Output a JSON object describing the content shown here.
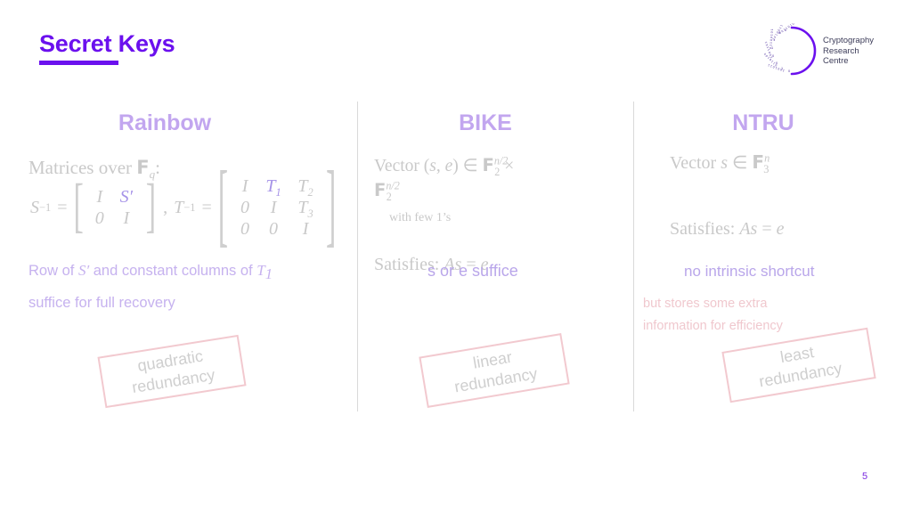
{
  "slide": {
    "title": "Secret Keys",
    "page_number": "5",
    "accent_color": "#6b10ee",
    "heading_color": "#c2a6ef",
    "math_color": "#c9c9c9",
    "purple_text_color": "#c6b2ef",
    "pink_text_color": "#f0c8ce",
    "stamp_border_color": "#f2c9cf"
  },
  "logo": {
    "name": "cryptography-research-centre-logo",
    "line1": "Cryptography",
    "line2": "Research",
    "line3": "Centre",
    "arc_color": "#6b10ee",
    "text_color": "#3b3b58",
    "bits": [
      "1",
      "0",
      "0",
      "1",
      "0",
      "1",
      "1",
      "0",
      "0",
      "1",
      "0",
      "1",
      "1",
      "0",
      "0",
      "1",
      "0",
      "1",
      "1",
      "0",
      "0",
      "1",
      "0",
      "1",
      "1",
      "0",
      "0",
      "1"
    ]
  },
  "columns": {
    "rainbow": {
      "heading": "Rainbow",
      "matrices_label_pre": "Matrices over ",
      "matrices_label_field": "F",
      "matrices_label_sub": "q",
      "matrices_label_post": ":",
      "s_inverse_label": "S",
      "s_inverse_exp": "−1",
      "equals": "=",
      "s_matrix": [
        [
          "I",
          "S′"
        ],
        [
          "0",
          "I"
        ]
      ],
      "s_matrix_highlight": [
        [
          false,
          true
        ],
        [
          false,
          false
        ]
      ],
      "comma": ",",
      "t_inverse_label": "T",
      "t_inverse_exp": "−1",
      "t_matrix": [
        [
          "I",
          "T",
          "T"
        ],
        [
          "0",
          "I",
          "T"
        ],
        [
          "0",
          "0",
          "I"
        ]
      ],
      "t_subscripts": [
        [
          "",
          "1",
          "2"
        ],
        [
          "",
          "",
          "3"
        ],
        [
          "",
          "",
          ""
        ]
      ],
      "t_matrix_highlight": [
        [
          false,
          true,
          false
        ],
        [
          false,
          false,
          false
        ],
        [
          false,
          false,
          false
        ]
      ],
      "note_line1_a": "Row of ",
      "note_line1_b": "S′",
      "note_line1_c": " and constant  columns of ",
      "note_line1_d": "T",
      "note_line1_sub": "1",
      "note_line2": "suffice for full recovery",
      "stamp": "quadratic\nredundancy"
    },
    "bike": {
      "heading": "BIKE",
      "vector_pre": "Vector (",
      "vector_s": "s",
      "vector_comma": ", ",
      "vector_e": "e",
      "vector_in": ") ∈ ",
      "field": "F",
      "field_sub": "2",
      "field_sup": "n/2",
      "times": " ×",
      "field2": "F",
      "field2_sub": "2",
      "field2_sup": "n/2",
      "few_ones": "with few 1’s",
      "satisfies_label": "Satisfies:  ",
      "satisfies_expr_A": "As",
      "satisfies_eq": " = ",
      "satisfies_expr_e": "e",
      "suffice_note": "s or e suffice",
      "stamp": "linear\nredundancy"
    },
    "ntru": {
      "heading": "NTRU",
      "vector_pre": "Vector  ",
      "vector_s": "s",
      "vector_in": " ∈ ",
      "field": "F",
      "field_sub": "3",
      "field_sup": "n",
      "satisfies_label": "Satisfies:  ",
      "satisfies_expr_A": "As",
      "satisfies_eq": " = ",
      "satisfies_expr_e": "e",
      "shortcut_note": "no intrinsic shortcut",
      "extra_line1": "but stores some extra",
      "extra_line2": "information for efficiency",
      "stamp": "least\nredundancy"
    }
  }
}
